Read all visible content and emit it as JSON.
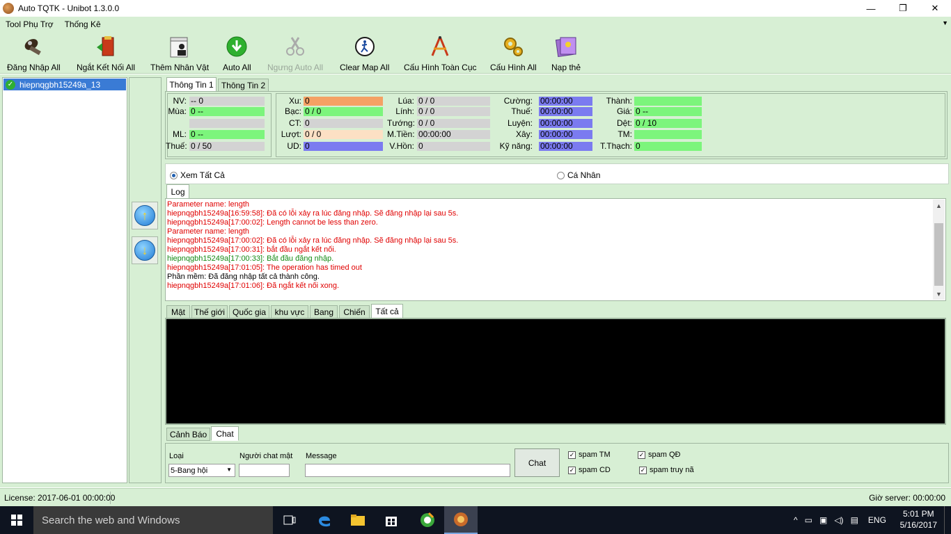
{
  "window": {
    "title": "Auto TQTK - Unibot 1.3.0.0",
    "minimize": "—",
    "maximize": "❐",
    "close": "✕"
  },
  "menu": {
    "items": [
      "Tool Phụ Trợ",
      "Thống Kê"
    ],
    "overflow": "▼"
  },
  "toolbar": {
    "buttons": [
      {
        "label": "Đăng Nhập All",
        "icon": "login-icon"
      },
      {
        "label": "Ngắt Kết Nối All",
        "icon": "exit-door-icon"
      },
      {
        "label": "Thêm Nhân Vật",
        "icon": "add-character-icon"
      },
      {
        "label": "Auto All",
        "icon": "green-download-icon"
      },
      {
        "label": "Ngưng Auto All",
        "icon": "scissors-icon",
        "disabled": true
      },
      {
        "label": "Clear Map All",
        "icon": "running-man-icon"
      },
      {
        "label": "Cấu Hình Toàn Cục",
        "icon": "compass-icon"
      },
      {
        "label": "Cấu Hình All",
        "icon": "gears-icon"
      },
      {
        "label": "Nạp thẻ",
        "icon": "card-icon"
      }
    ]
  },
  "accounts": {
    "items": [
      "hiepnqgbh15249a_13"
    ],
    "selected": 0
  },
  "arrows": {
    "up": "↑",
    "down": "↓"
  },
  "info_tabs": [
    "Thông Tin 1",
    "Thông Tin 2"
  ],
  "info": {
    "left": [
      {
        "label": "NV:",
        "value": "-- 0",
        "color": "#d3d3d3"
      },
      {
        "label": "Mùa:",
        "value": "0 --",
        "color": "#7cf57c"
      },
      {
        "label": "",
        "value": "",
        "color": "#d3d3d3"
      },
      {
        "label": "ML:",
        "value": "0 --",
        "color": "#7cf57c"
      },
      {
        "label": "Thuế:",
        "value": "0 / 50",
        "color": "#d3d3d3"
      }
    ],
    "col1": [
      {
        "label": "Xu:",
        "value": "0",
        "color": "#f5a164"
      },
      {
        "label": "Bạc:",
        "value": "0 / 0",
        "color": "#7cf57c"
      },
      {
        "label": "CT:",
        "value": "0",
        "color": "#d3d3d3"
      },
      {
        "label": "Lượt:",
        "value": "0 / 0",
        "color": "#fce0c4"
      },
      {
        "label": "UD:",
        "value": "0",
        "color": "#7b7bf0"
      }
    ],
    "col2": [
      {
        "label": "Lúa:",
        "value": "0 / 0",
        "color": "#d3d3d3"
      },
      {
        "label": "Lính:",
        "value": "0 / 0",
        "color": "#d3d3d3"
      },
      {
        "label": "Tướng:",
        "value": "0 / 0",
        "color": "#d3d3d3"
      },
      {
        "label": "M.Tiền:",
        "value": "00:00:00",
        "color": "#d3d3d3"
      },
      {
        "label": "V.Hồn:",
        "value": "0",
        "color": "#d3d3d3"
      }
    ],
    "col3": [
      {
        "label": "Cường:",
        "value": "00:00:00",
        "color": "#7b7bf0"
      },
      {
        "label": "Thuế:",
        "value": "00:00:00",
        "color": "#7b7bf0"
      },
      {
        "label": "Luyện:",
        "value": "00:00:00",
        "color": "#7b7bf0"
      },
      {
        "label": "Xây:",
        "value": "00:00:00",
        "color": "#7b7bf0"
      },
      {
        "label": "Kỹ năng:",
        "value": "00:00:00",
        "color": "#7b7bf0"
      }
    ],
    "col4": [
      {
        "label": "Thành:",
        "value": "",
        "color": "#7cf57c"
      },
      {
        "label": "Giá:",
        "value": "0 --",
        "color": "#7cf57c"
      },
      {
        "label": "Dệt:",
        "value": "0 / 10",
        "color": "#7cf57c"
      },
      {
        "label": "TM:",
        "value": "",
        "color": "#7cf57c"
      },
      {
        "label": "T.Thạch:",
        "value": "0",
        "color": "#7cf57c"
      }
    ]
  },
  "view": {
    "all_label": "Xem Tất Cả",
    "personal_label": "Cá Nhân",
    "selected": "all"
  },
  "log": {
    "tab": "Log",
    "lines": [
      {
        "text": "Parameter name: length",
        "color": "red"
      },
      {
        "text": "hiepnqgbh15249a[16:59:58]: Đã có lỗi xảy ra lúc đăng nhập. Sẽ đăng nhập lại sau 5s.",
        "color": "red"
      },
      {
        "text": "hiepnqgbh15249a[17:00:02]: Length cannot be less than zero.",
        "color": "red"
      },
      {
        "text": "Parameter name: length",
        "color": "red"
      },
      {
        "text": "hiepnqgbh15249a[17:00:02]: Đã có lỗi xảy ra lúc đăng nhập. Sẽ đăng nhập lại sau 5s.",
        "color": "red"
      },
      {
        "text": "hiepnqgbh15249a[17:00:31]: bắt đầu ngắt kết nối.",
        "color": "red"
      },
      {
        "text": "hiepnqgbh15249a[17:00:33]: Bắt đầu đăng nhập.",
        "color": "green"
      },
      {
        "text": "hiepnqgbh15249a[17:01:05]: The operation has timed out",
        "color": "red"
      },
      {
        "text": "Phần mềm: Đã đăng nhập tất cả thành công.",
        "color": "black"
      },
      {
        "text": "hiepnqgbh15249a[17:01:06]: Đã ngắt kết nối xong.",
        "color": "red"
      }
    ]
  },
  "chat_tabs": [
    "Mật",
    "Thế giới",
    "Quốc gia",
    "khu vực",
    "Bang",
    "Chiến",
    "Tất cả"
  ],
  "chat_tab_active": 6,
  "bottom_tabs": [
    "Cảnh Báo",
    "Chat"
  ],
  "bottom_tab_active": 1,
  "chat": {
    "type_label": "Loại",
    "type_value": "5-Bang hội",
    "private_label": "Người chat mật",
    "message_label": "Message",
    "send": "Chat",
    "checks": [
      {
        "label": "spam TM",
        "checked": true
      },
      {
        "label": "spam CD",
        "checked": true
      },
      {
        "label": "spam QĐ",
        "checked": true
      },
      {
        "label": "spam truy nã",
        "checked": true
      }
    ]
  },
  "status": {
    "license": "License: 2017-06-01 00:00:00",
    "server_time": "Giờ server: 00:00:00"
  },
  "taskbar": {
    "search_placeholder": "Search the web and Windows",
    "lang": "ENG",
    "time": "5:01 PM",
    "date": "5/16/2017"
  }
}
